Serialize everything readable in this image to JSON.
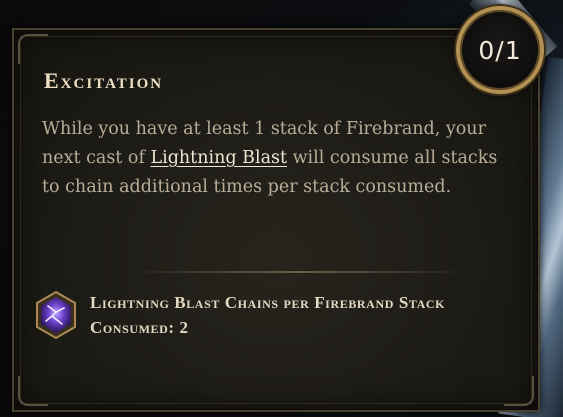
{
  "skill_node": {
    "title": "Excitation",
    "rank": "0/1",
    "description": {
      "part1": "While you have at least 1 stack of Firebrand, your next cast of ",
      "link": "Lightning Blast",
      "part2": " will consume all stacks to chain additional times per stack consumed."
    },
    "modifier": {
      "icon": "lightning-gem-icon",
      "text": "Lightning Blast Chains per Firebrand Stack Consumed: 2"
    }
  },
  "colors": {
    "panel_bg": "#1d1b16",
    "title": "#ecdfc3",
    "body_text": "#b9ad98",
    "link_text": "#efe6d2",
    "badge_gold": "#b29153",
    "icon_purple": "#6a3fc8"
  }
}
